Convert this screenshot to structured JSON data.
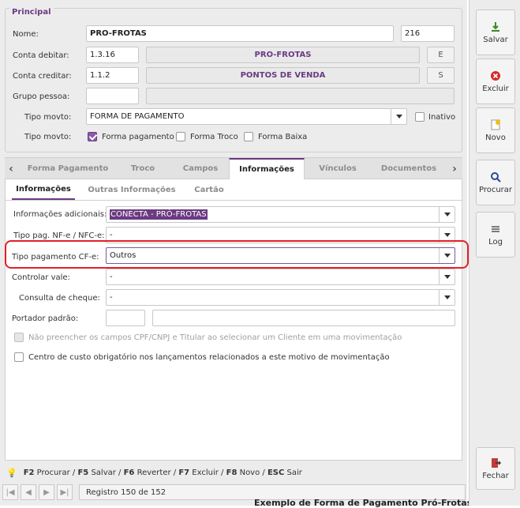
{
  "principal": {
    "legend": "Principal",
    "nome_label": "Nome:",
    "nome_value": "PRO-FROTAS",
    "codigo_value": "216",
    "conta_debitar_label": "Conta debitar:",
    "conta_debitar_value": "1.3.16",
    "conta_debitar_desc": "PRO-FROTAS",
    "conta_debitar_flag": "E",
    "conta_creditar_label": "Conta creditar:",
    "conta_creditar_value": "1.1.2",
    "conta_creditar_desc": "PONTOS DE VENDA",
    "conta_creditar_flag": "S",
    "grupo_pessoa_label": "Grupo pessoa:",
    "tipo_movto_label": "Tipo movto:",
    "tipo_movto_value": "FORMA DE PAGAMENTO",
    "inativo_label": "Inativo",
    "tipo_movto2_label": "Tipo movto:",
    "check_forma_pagamento": "Forma pagamento",
    "check_forma_troco": "Forma Troco",
    "check_forma_baixa": "Forma Baixa"
  },
  "tabs": [
    "Forma Pagamento",
    "Troco",
    "Campos",
    "Informações",
    "Vínculos",
    "Documentos"
  ],
  "subtabs": [
    "Informações",
    "Outras Informações",
    "Cartão"
  ],
  "info": {
    "info_adic_label": "Informações adicionais:",
    "info_adic_value": "CONECTA - PRÓ-FROTAS",
    "tipo_pag_label": "Tipo pag. NF-e / NFC-e:",
    "tipo_pag_value": "-",
    "tipo_cfe_label": "Tipo pagamento CF-e:",
    "tipo_cfe_value": "Outros",
    "controlar_vale_label": "Controlar vale:",
    "controlar_vale_value": "-",
    "consulta_cheque_label": "Consulta de cheque:",
    "consulta_cheque_value": "-",
    "portador_label": "Portador padrão:",
    "check_cpf": "Não preencher os campos CPF/CNPJ e Titular ao selecionar um Cliente em uma movimentação",
    "check_centro": "Centro de custo obrigatório nos lançamentos relacionados a este motivo de movimentação"
  },
  "status": {
    "shortcuts": [
      {
        "key": "F2",
        "action": " Procurar / "
      },
      {
        "key": "F5",
        "action": " Salvar / "
      },
      {
        "key": "F6",
        "action": " Reverter / "
      },
      {
        "key": "F7",
        "action": " Excluir / "
      },
      {
        "key": "F8",
        "action": " Novo / "
      },
      {
        "key": "ESC",
        "action": " Sair"
      }
    ],
    "registro": "Registro 150 de 152"
  },
  "sidebar": {
    "salvar": "Salvar",
    "excluir": "Excluir",
    "novo": "Novo",
    "procurar": "Procurar",
    "log": "Log",
    "fechar": "Fechar"
  },
  "caption": "Exemplo de Forma de Pagamento Pró-Frotas",
  "colors": {
    "accent": "#6b3a82",
    "highlight": "#e0202a"
  }
}
